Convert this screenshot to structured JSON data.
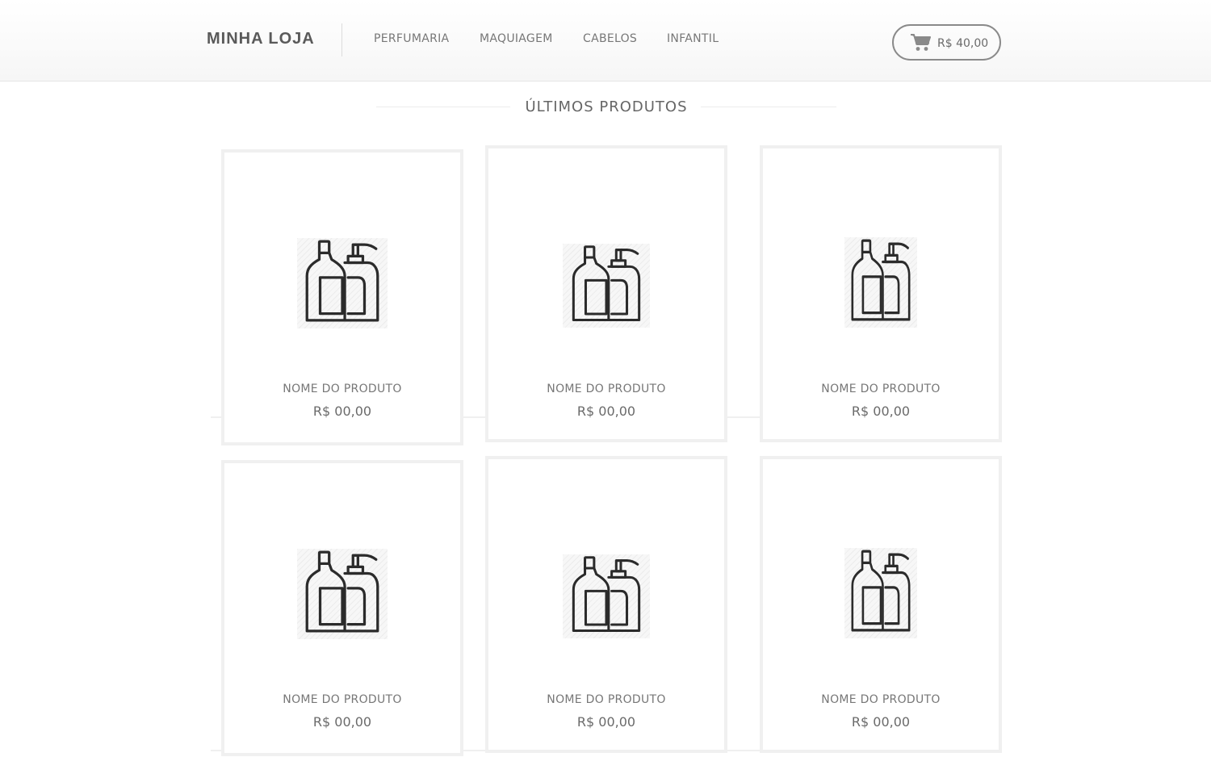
{
  "header": {
    "brand": "MINHA LOJA",
    "nav": [
      {
        "label": "PERFUMARIA"
      },
      {
        "label": "MAQUIAGEM"
      },
      {
        "label": "CABELOS"
      },
      {
        "label": "INFANTIL"
      }
    ],
    "cart": {
      "icon": "cart-icon",
      "total": "R$ 40,00"
    }
  },
  "section": {
    "title": "ÚLTIMOS PRODUTOS"
  },
  "products": [
    {
      "name": "NOME DO PRODUTO",
      "price": "R$ 00,00",
      "icon": "bottles-icon"
    },
    {
      "name": "NOME DO PRODUTO",
      "price": "R$ 00,00",
      "icon": "bottles-icon"
    },
    {
      "name": "NOME DO PRODUTO",
      "price": "R$ 00,00",
      "icon": "bottles-icon"
    },
    {
      "name": "NOME DO PRODUTO",
      "price": "R$ 00,00",
      "icon": "bottles-icon"
    },
    {
      "name": "NOME DO PRODUTO",
      "price": "R$ 00,00",
      "icon": "bottles-icon"
    },
    {
      "name": "NOME DO PRODUTO",
      "price": "R$ 00,00",
      "icon": "bottles-icon"
    }
  ],
  "colors": {
    "text": "#555555",
    "border": "#f0f0f0",
    "header_bg": "#f6f6f6"
  }
}
